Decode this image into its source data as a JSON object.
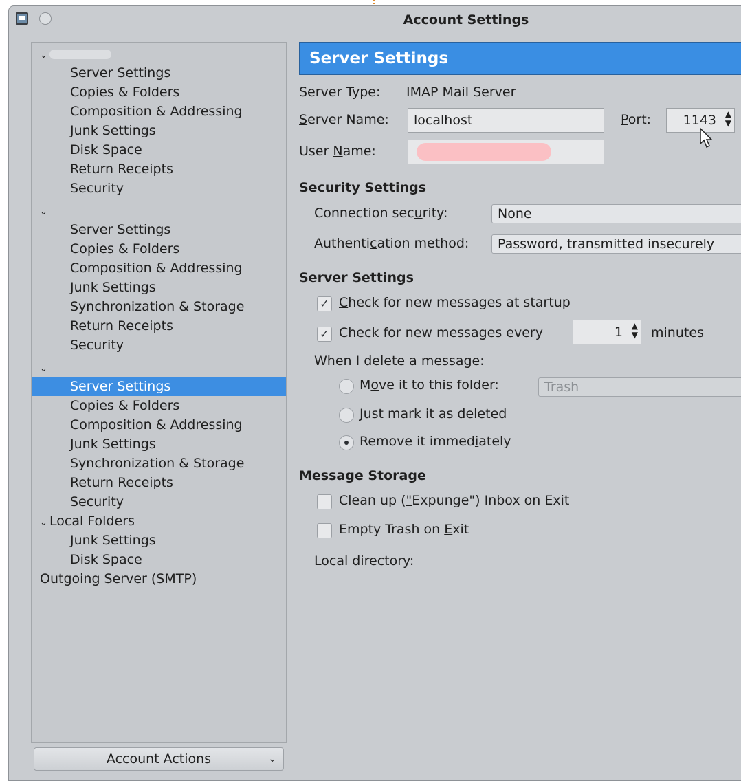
{
  "window": {
    "title": "Account Settings"
  },
  "tree": {
    "rows": [
      {
        "text": "",
        "level": 0,
        "expanded": true
      },
      {
        "text": "Server Settings",
        "level": 1
      },
      {
        "text": "Copies & Folders",
        "level": 1
      },
      {
        "text": "Composition & Addressing",
        "level": 1
      },
      {
        "text": "Junk Settings",
        "level": 1
      },
      {
        "text": "Disk Space",
        "level": 1
      },
      {
        "text": "Return Receipts",
        "level": 1
      },
      {
        "text": "Security",
        "level": 1
      },
      {
        "text": "",
        "level": 0,
        "expanded": true
      },
      {
        "text": "Server Settings",
        "level": 1
      },
      {
        "text": "Copies & Folders",
        "level": 1
      },
      {
        "text": "Composition & Addressing",
        "level": 1
      },
      {
        "text": "Junk Settings",
        "level": 1
      },
      {
        "text": "Synchronization & Storage",
        "level": 1
      },
      {
        "text": "Return Receipts",
        "level": 1
      },
      {
        "text": "Security",
        "level": 1
      },
      {
        "text": "",
        "level": 0,
        "expanded": true
      },
      {
        "text": "Server Settings",
        "level": 1,
        "selected": true
      },
      {
        "text": "Copies & Folders",
        "level": 1
      },
      {
        "text": "Composition & Addressing",
        "level": 1
      },
      {
        "text": "Junk Settings",
        "level": 1
      },
      {
        "text": "Synchronization & Storage",
        "level": 1
      },
      {
        "text": "Return Receipts",
        "level": 1
      },
      {
        "text": "Security",
        "level": 1
      },
      {
        "text": "Local Folders",
        "level": 0,
        "expanded": true
      },
      {
        "text": "Junk Settings",
        "level": 1
      },
      {
        "text": "Disk Space",
        "level": 1
      },
      {
        "text": "Outgoing Server (SMTP)",
        "level": 0
      }
    ],
    "account_actions": "Account Actions"
  },
  "panel": {
    "header": "Server Settings",
    "server_type_label": "Server Type:",
    "server_type_value": "IMAP Mail Server",
    "server_name_label": "Server Name:",
    "server_name_value": "localhost",
    "port_label": "Port:",
    "port_value": "1143",
    "user_name_label": "User Name:",
    "security_heading": "Security Settings",
    "connection_security_label": "Connection security:",
    "connection_security_value": "None",
    "auth_method_label": "Authentication method:",
    "auth_method_value": "Password, transmitted insecurely",
    "server_heading": "Server Settings",
    "check_startup_label": "Check for new messages at startup",
    "check_startup_checked": true,
    "check_every_label": "Check for new messages every",
    "check_every_checked": true,
    "check_every_value": "1",
    "minutes_label": "minutes",
    "when_delete_label": "When I delete a message:",
    "move_folder_label": "Move it to this folder:",
    "move_folder_value": "Trash",
    "mark_deleted_label": "Just mark it as deleted",
    "remove_label": "Remove it immediately",
    "delete_action_selected": "remove",
    "storage_heading": "Message Storage",
    "expunge_label": "Clean up (\"Expunge\") Inbox on Exit",
    "expunge_checked": false,
    "empty_trash_label": "Empty Trash on Exit",
    "empty_trash_checked": false,
    "local_directory_label": "Local directory:"
  },
  "colors": {
    "selection": "#3d8ee2",
    "header": "#3a8ee3",
    "background": "#c9ccd0",
    "redaction": "#fbc0c4"
  }
}
